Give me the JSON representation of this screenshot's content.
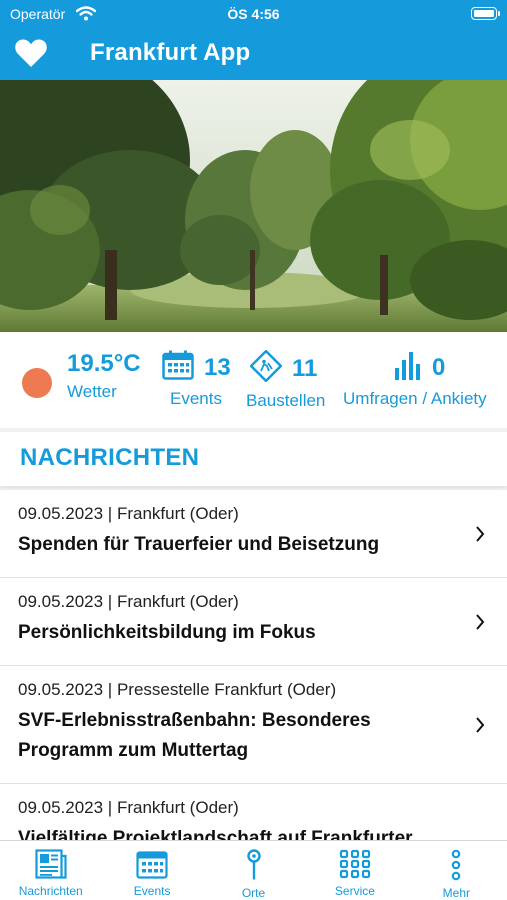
{
  "status_bar": {
    "carrier": "Operatör",
    "time": "ÖS 4:56"
  },
  "nav": {
    "title": "Frankfurt App"
  },
  "stats": {
    "weather": {
      "value": "19.5°C",
      "label": "Wetter"
    },
    "events": {
      "value": "13",
      "label": "Events"
    },
    "construction": {
      "value": "11",
      "label": "Baustellen"
    },
    "surveys": {
      "value": "0",
      "label": "Umfragen / Ankiety"
    }
  },
  "section": {
    "title": "NACHRICHTEN"
  },
  "news": [
    {
      "meta": "09.05.2023 | Frankfurt (Oder)",
      "title": "Spenden für Trauerfeier und Beisetzung"
    },
    {
      "meta": "09.05.2023 | Frankfurt (Oder)",
      "title": "Persönlichkeitsbildung im Fokus"
    },
    {
      "meta": "09.05.2023 | Pressestelle Frankfurt (Oder)",
      "title": "SVF-Erlebnisstraßenbahn: Besonderes Programm zum Muttertag"
    },
    {
      "meta": "09.05.2023 | Frankfurt (Oder)",
      "title": "Vielfältige Projektlandschaft auf Frankfurter"
    }
  ],
  "tabs": {
    "news": "Nachrichten",
    "events": "Events",
    "places": "Orte",
    "service": "Service",
    "more": "Mehr"
  },
  "colors": {
    "accent": "#159bdb",
    "weather_sun": "#ee7a52"
  }
}
